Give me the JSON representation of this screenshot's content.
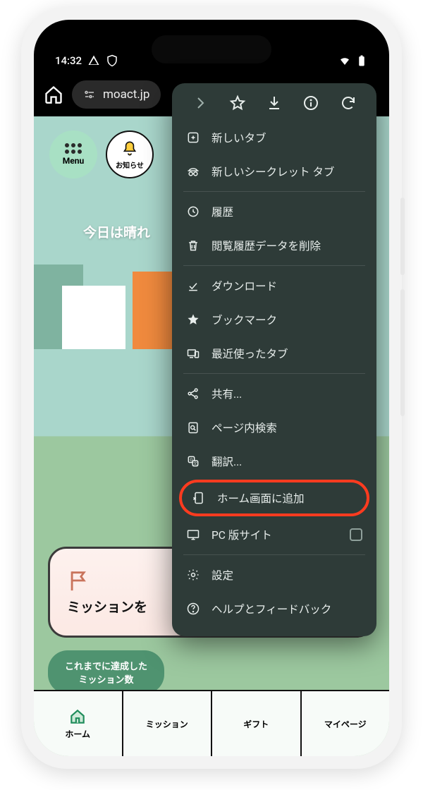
{
  "status": {
    "time": "14:32",
    "wifi": true,
    "battery": true
  },
  "toolbar": {
    "url": "moact.jp"
  },
  "chips": {
    "menu": "Menu",
    "bell": "お知らせ"
  },
  "weather": {
    "text": "今日は晴れ"
  },
  "mission": {
    "card_label": "ミッションを",
    "stats_label": "これまでに達成した\nミッション数"
  },
  "bottomnav": [
    {
      "label": "ホーム"
    },
    {
      "label": "ミッション"
    },
    {
      "label": "ギフト"
    },
    {
      "label": "マイページ"
    }
  ],
  "menu": {
    "items": [
      {
        "icon": "plus-square",
        "label": "新しいタブ"
      },
      {
        "icon": "incognito",
        "label": "新しいシークレット タブ"
      },
      {
        "divider": true
      },
      {
        "icon": "history",
        "label": "履歴"
      },
      {
        "icon": "trash",
        "label": "閲覧履歴データを削除"
      },
      {
        "divider": true
      },
      {
        "icon": "download-done",
        "label": "ダウンロード"
      },
      {
        "icon": "star-filled",
        "label": "ブックマーク"
      },
      {
        "icon": "devices",
        "label": "最近使ったタブ"
      },
      {
        "divider": true
      },
      {
        "icon": "share",
        "label": "共有..."
      },
      {
        "icon": "find",
        "label": "ページ内検索"
      },
      {
        "icon": "translate",
        "label": "翻訳..."
      },
      {
        "icon": "add-home",
        "label": "ホーム画面に追加",
        "highlighted": true
      },
      {
        "icon": "desktop",
        "label": "PC 版サイト",
        "checkbox": true
      },
      {
        "divider": true
      },
      {
        "icon": "gear",
        "label": "設定"
      },
      {
        "icon": "help",
        "label": "ヘルプとフィードバック"
      }
    ]
  }
}
